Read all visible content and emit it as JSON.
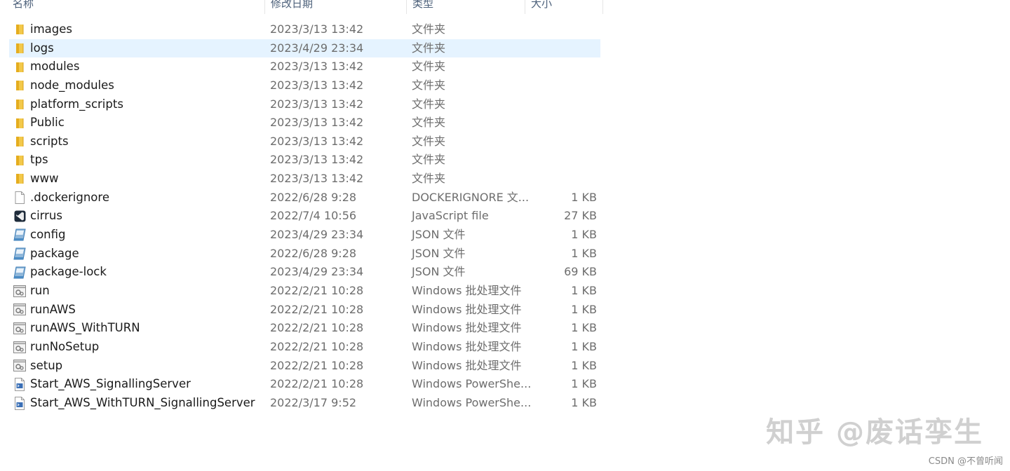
{
  "columns": {
    "name": "名称",
    "date": "修改日期",
    "type": "类型",
    "size": "大小"
  },
  "files": [
    {
      "name": "images",
      "date": "2023/3/13 13:42",
      "type": "文件夹",
      "size": "",
      "icon": "folder-icon"
    },
    {
      "name": "logs",
      "date": "2023/4/29 23:34",
      "type": "文件夹",
      "size": "",
      "icon": "folder-icon",
      "selected": true
    },
    {
      "name": "modules",
      "date": "2023/3/13 13:42",
      "type": "文件夹",
      "size": "",
      "icon": "folder-icon"
    },
    {
      "name": "node_modules",
      "date": "2023/3/13 13:42",
      "type": "文件夹",
      "size": "",
      "icon": "folder-icon"
    },
    {
      "name": "platform_scripts",
      "date": "2023/3/13 13:42",
      "type": "文件夹",
      "size": "",
      "icon": "folder-icon"
    },
    {
      "name": "Public",
      "date": "2023/3/13 13:42",
      "type": "文件夹",
      "size": "",
      "icon": "folder-icon"
    },
    {
      "name": "scripts",
      "date": "2023/3/13 13:42",
      "type": "文件夹",
      "size": "",
      "icon": "folder-icon"
    },
    {
      "name": "tps",
      "date": "2023/3/13 13:42",
      "type": "文件夹",
      "size": "",
      "icon": "folder-icon"
    },
    {
      "name": "www",
      "date": "2023/3/13 13:42",
      "type": "文件夹",
      "size": "",
      "icon": "folder-icon"
    },
    {
      "name": ".dockerignore",
      "date": "2022/6/28 9:28",
      "type": "DOCKERIGNORE 文...",
      "size": "1 KB",
      "icon": "file-icon"
    },
    {
      "name": "cirrus",
      "date": "2022/7/4 10:56",
      "type": "JavaScript file",
      "size": "27 KB",
      "icon": "vscode-icon"
    },
    {
      "name": "config",
      "date": "2023/4/29 23:34",
      "type": "JSON 文件",
      "size": "1 KB",
      "icon": "json-icon"
    },
    {
      "name": "package",
      "date": "2022/6/28 9:28",
      "type": "JSON 文件",
      "size": "1 KB",
      "icon": "json-icon"
    },
    {
      "name": "package-lock",
      "date": "2023/4/29 23:34",
      "type": "JSON 文件",
      "size": "69 KB",
      "icon": "json-icon"
    },
    {
      "name": "run",
      "date": "2022/2/21 10:28",
      "type": "Windows 批处理文件",
      "size": "1 KB",
      "icon": "batch-icon"
    },
    {
      "name": "runAWS",
      "date": "2022/2/21 10:28",
      "type": "Windows 批处理文件",
      "size": "1 KB",
      "icon": "batch-icon"
    },
    {
      "name": "runAWS_WithTURN",
      "date": "2022/2/21 10:28",
      "type": "Windows 批处理文件",
      "size": "1 KB",
      "icon": "batch-icon"
    },
    {
      "name": "runNoSetup",
      "date": "2022/2/21 10:28",
      "type": "Windows 批处理文件",
      "size": "1 KB",
      "icon": "batch-icon"
    },
    {
      "name": "setup",
      "date": "2022/2/21 10:28",
      "type": "Windows 批处理文件",
      "size": "1 KB",
      "icon": "batch-icon"
    },
    {
      "name": "Start_AWS_SignallingServer",
      "date": "2022/2/21 10:28",
      "type": "Windows PowerShe...",
      "size": "1 KB",
      "icon": "powershell-icon"
    },
    {
      "name": "Start_AWS_WithTURN_SignallingServer",
      "date": "2022/3/17 9:52",
      "type": "Windows PowerShe...",
      "size": "1 KB",
      "icon": "powershell-icon"
    }
  ],
  "watermark": {
    "zhihu": "知乎 @废话孪生",
    "csdn": "CSDN @不曾听闻"
  },
  "colors": {
    "selection": "#e5f3ff",
    "folder": "#f3c94a",
    "header_text": "#4c607a",
    "meta_text": "#6d6d6d"
  }
}
